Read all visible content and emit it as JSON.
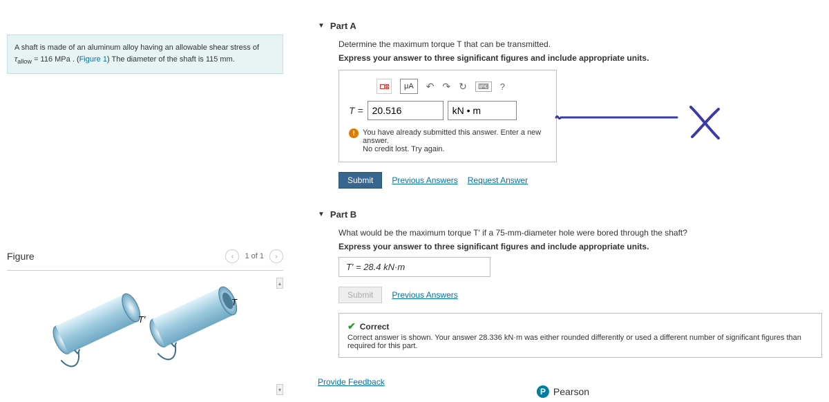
{
  "problem": {
    "text_prefix": "A shaft is made of an aluminum alloy having an allowable shear stress of ",
    "tau_var": "τ",
    "tau_sub": "allow",
    "eq": " = ",
    "tau_value": "116 MPa",
    "text_mid": ". (",
    "figure_link": "Figure 1",
    "text_suffix": ") The diameter of the shaft is 115 mm."
  },
  "figure": {
    "title": "Figure",
    "pager_text": "1 of 1",
    "label_T": "T",
    "label_Tp": "T′"
  },
  "partA": {
    "title": "Part A",
    "instr1": "Determine the maximum torque T that can be transmitted.",
    "instr2": "Express your answer to three significant figures and include appropriate units.",
    "toolbar": {
      "ua": "μA",
      "undo": "↶",
      "redo": "↷",
      "refresh": "↻",
      "kbd": "⌨",
      "help": "?"
    },
    "eq_label": "T = ",
    "value": "20.516",
    "unit": "kN • m",
    "feedback_line1": "You have already submitted this answer. Enter a new answer.",
    "feedback_line2": "No credit lost. Try again.",
    "submit": "Submit",
    "prev": "Previous Answers",
    "request": "Request Answer"
  },
  "partB": {
    "title": "Part B",
    "instr1": "What would be the maximum torque T′ if a 75-mm-diameter hole were bored through the shaft?",
    "instr2": "Express your answer to three significant figures and include appropriate units.",
    "answer_display": "T′ = 28.4 kN·m",
    "submit": "Submit",
    "prev": "Previous Answers",
    "correct_label": "Correct",
    "correct_msg": "Correct answer is shown. Your answer 28.336 kN·m was either rounded differently or used a different number of significant figures than required for this part."
  },
  "footer": {
    "provide_feedback": "Provide Feedback",
    "pearson": "Pearson"
  }
}
